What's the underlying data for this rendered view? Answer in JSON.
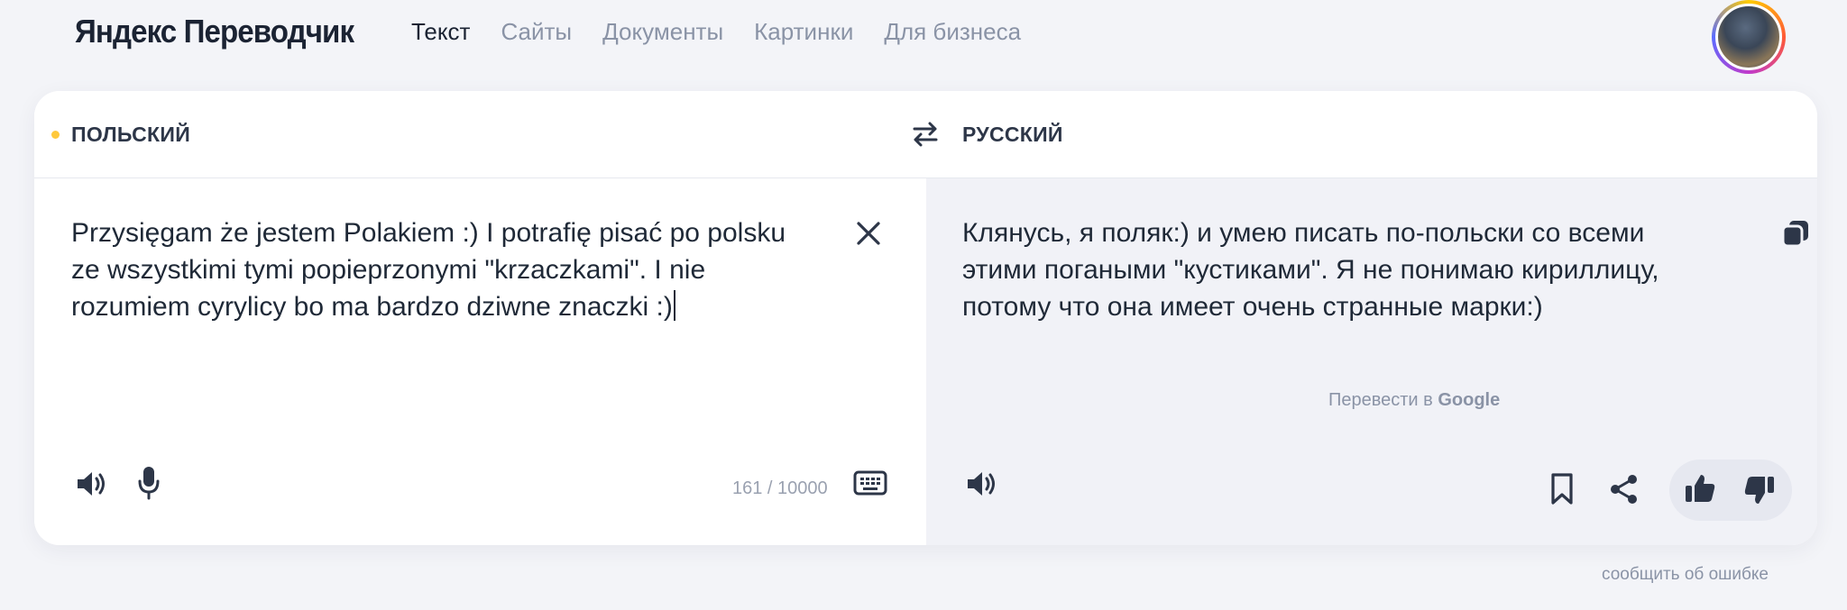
{
  "header": {
    "logo": "Яндекс Переводчик",
    "nav": [
      {
        "label": "Текст",
        "active": true
      },
      {
        "label": "Сайты",
        "active": false
      },
      {
        "label": "Документы",
        "active": false
      },
      {
        "label": "Картинки",
        "active": false
      },
      {
        "label": "Для бизнеса",
        "active": false
      }
    ]
  },
  "languages": {
    "source": "ПОЛЬСКИЙ",
    "target": "РУССКИЙ"
  },
  "source": {
    "text": "Przysięgam że jestem Polakiem :) I potrafię pisać po polsku ze wszystkimi tymi popieprzonymi \"krzaczkami\". I nie rozumiem cyrylicy bo ma bardzo dziwne znaczki :)",
    "counter": "161 / 10000"
  },
  "translation": {
    "text": "Клянусь, я поляк:) и умею писать по-польски со всеми этими погаными \"кустиками\". Я не понимаю кириллицу, потому что она имеет очень странные марки:)",
    "google_prefix": "Перевести в",
    "google_brand": "Google"
  },
  "footer": {
    "report": "сообщить об ошибке"
  },
  "colors": {
    "accent_dot": "#ffc93c",
    "text_dark": "#1b2333",
    "text_muted": "#8a93a6",
    "right_pane_bg": "#f1f2f7"
  },
  "icons": [
    "swap-icon",
    "clear-icon",
    "speaker-icon",
    "microphone-icon",
    "keyboard-icon",
    "copy-icon",
    "bookmark-icon",
    "share-icon",
    "thumbs-up-icon",
    "thumbs-down-icon"
  ]
}
